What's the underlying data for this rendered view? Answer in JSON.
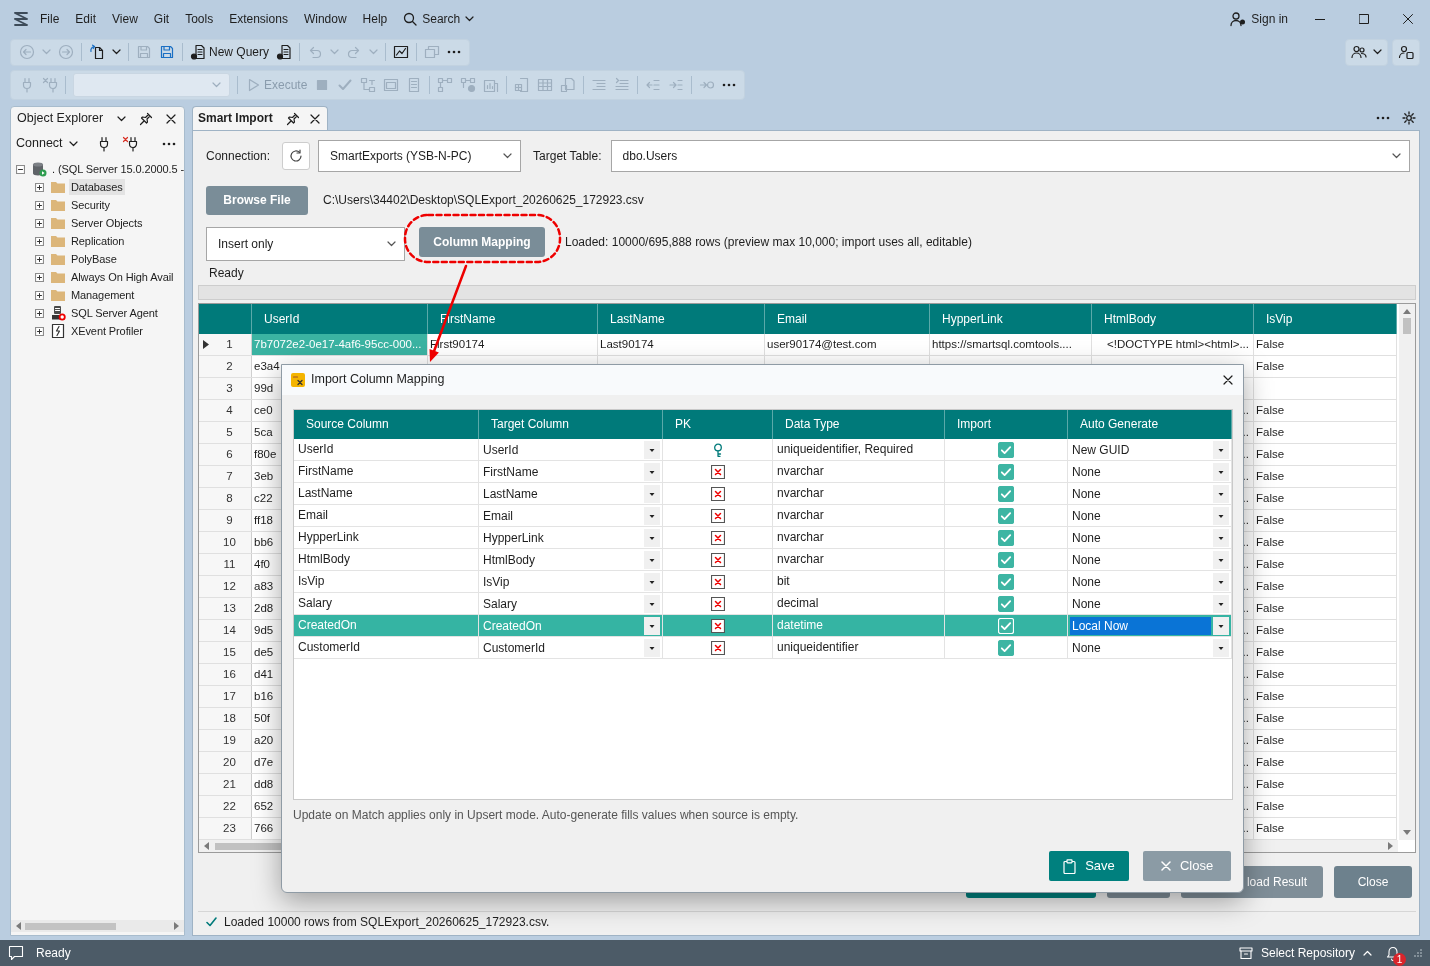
{
  "menu": {
    "items": [
      "File",
      "Edit",
      "View",
      "Git",
      "Tools",
      "Extensions",
      "Window",
      "Help"
    ],
    "search": "Search"
  },
  "account": {
    "label": "Sign in"
  },
  "toolbars": [
    {
      "items": [
        {
          "kind": "back",
          "disabled": true
        },
        {
          "kind": "chevron",
          "disabled": true
        },
        {
          "kind": "forward",
          "disabled": true
        },
        {
          "kind": "separator"
        },
        {
          "kind": "new-file",
          "disabled": false
        },
        {
          "kind": "chevron",
          "disabled": false
        },
        {
          "kind": "separator"
        },
        {
          "kind": "save",
          "disabled": true
        },
        {
          "kind": "save-all",
          "disabled": false
        },
        {
          "kind": "separator"
        },
        {
          "kind": "new-query",
          "label": "New Query",
          "disabled": false
        },
        {
          "kind": "query-file",
          "disabled": false
        },
        {
          "kind": "separator"
        },
        {
          "kind": "undo",
          "disabled": true
        },
        {
          "kind": "chevron",
          "disabled": true
        },
        {
          "kind": "redo",
          "disabled": true
        },
        {
          "kind": "chevron",
          "disabled": true
        },
        {
          "kind": "separator"
        },
        {
          "kind": "monitor",
          "disabled": false
        },
        {
          "kind": "separator"
        },
        {
          "kind": "window",
          "disabled": true
        },
        {
          "kind": "more",
          "disabled": false
        }
      ],
      "right": [
        {
          "items": [
            {
              "kind": "people",
              "disabled": false
            },
            {
              "kind": "chevron",
              "disabled": false
            }
          ]
        },
        {
          "items": [
            {
              "kind": "feedback",
              "disabled": false
            }
          ]
        }
      ]
    },
    {
      "items": [
        {
          "kind": "plug",
          "disabled": true
        },
        {
          "kind": "plug-x",
          "disabled": true
        },
        {
          "kind": "separator"
        },
        {
          "kind": "combo",
          "disabled": true
        },
        {
          "kind": "separator"
        },
        {
          "kind": "execute",
          "label": "Execute",
          "disabled": true
        },
        {
          "kind": "stop",
          "disabled": true
        },
        {
          "kind": "check",
          "disabled": true
        },
        {
          "kind": "diagram",
          "disabled": true
        },
        {
          "kind": "windows",
          "disabled": true
        },
        {
          "kind": "sheet",
          "disabled": true
        },
        {
          "kind": "separator"
        },
        {
          "kind": "flow",
          "disabled": true
        },
        {
          "kind": "flow-check",
          "disabled": true
        },
        {
          "kind": "bars",
          "disabled": true
        },
        {
          "kind": "separator"
        },
        {
          "kind": "doc-grid",
          "disabled": true
        },
        {
          "kind": "table",
          "disabled": true
        },
        {
          "kind": "doc-small",
          "disabled": true
        },
        {
          "kind": "separator"
        },
        {
          "kind": "comment",
          "disabled": true
        },
        {
          "kind": "uncomment",
          "disabled": true
        },
        {
          "kind": "separator"
        },
        {
          "kind": "outdent",
          "disabled": true
        },
        {
          "kind": "indent",
          "disabled": true
        },
        {
          "kind": "separator"
        },
        {
          "kind": "mail-arrow",
          "disabled": true
        },
        {
          "kind": "more",
          "disabled": false
        }
      ]
    }
  ],
  "object_explorer": {
    "title": "Object Explorer",
    "connect": "Connect",
    "tree": [
      {
        "label": ". (SQL Server 15.0.2000.5 -",
        "kind": "server",
        "expanded": true,
        "selected": false,
        "children": [
          {
            "label": "Databases",
            "kind": "folder",
            "expanded": false,
            "selected": true
          },
          {
            "label": "Security",
            "kind": "folder",
            "expanded": false,
            "selected": false
          },
          {
            "label": "Server Objects",
            "kind": "folder",
            "expanded": false,
            "selected": false
          },
          {
            "label": "Replication",
            "kind": "folder",
            "expanded": false,
            "selected": false
          },
          {
            "label": "PolyBase",
            "kind": "folder",
            "expanded": false,
            "selected": false
          },
          {
            "label": "Always On High Avail",
            "kind": "folder",
            "expanded": false,
            "selected": false
          },
          {
            "label": "Management",
            "kind": "folder",
            "expanded": false,
            "selected": false
          },
          {
            "label": "SQL Server Agent",
            "kind": "agent",
            "expanded": false,
            "selected": false
          },
          {
            "label": "XEvent Profiler",
            "kind": "profiler",
            "expanded": false,
            "selected": false
          }
        ]
      }
    ]
  },
  "document": {
    "tab": "Smart Import",
    "connection_label": "Connection:",
    "connection": "SmartExports (YSB-N-PC)",
    "target_table_label": "Target Table:",
    "target_table": "dbo.Users",
    "browse_button": "Browse File",
    "file_path": "C:\\Users\\34402\\Desktop\\SQLExport_20260625_172923.csv",
    "mode": "Insert only",
    "mapping_button": "Column Mapping",
    "loaded_info": "Loaded: 10000/695,888 rows (preview max 10,000; import uses all, editable)",
    "status": "Ready",
    "grid": {
      "columns": [
        "UserId",
        "FirstName",
        "LastName",
        "Email",
        "HypperLink",
        "HtmlBody",
        "IsVip"
      ],
      "rows": [
        {
          "number": "1",
          "current": true,
          "user_id": "7b7072e2-0e17-4af6-95cc-000...",
          "first_name": "First90174",
          "last_name": "Last90174",
          "email": "user90174@test.com",
          "hyperlink": "https://smartsql.comtools....",
          "html_body": "<!DOCTYPE html><html>...",
          "is_vip": "False"
        },
        {
          "number": "2",
          "current": false,
          "user_id": "e3a4",
          "is_vip": "False"
        },
        {
          "number": "3",
          "current": false,
          "user_id": "99d"
        },
        {
          "number": "4",
          "current": false,
          "user_id": "ce0",
          "html_body": "..",
          "is_vip": "False"
        },
        {
          "number": "5",
          "current": false,
          "user_id": "5ca",
          "html_body": "..",
          "is_vip": "False"
        },
        {
          "number": "6",
          "current": false,
          "user_id": "f80e",
          "html_body": "..",
          "is_vip": "False"
        },
        {
          "number": "7",
          "current": false,
          "user_id": "3eb",
          "html_body": "..",
          "is_vip": "False"
        },
        {
          "number": "8",
          "current": false,
          "user_id": "c22",
          "html_body": "..",
          "is_vip": "False"
        },
        {
          "number": "9",
          "current": false,
          "user_id": "ff18",
          "html_body": "..",
          "is_vip": "False"
        },
        {
          "number": "10",
          "current": false,
          "user_id": "bb6",
          "html_body": "..",
          "is_vip": "False"
        },
        {
          "number": "11",
          "current": false,
          "user_id": "4f0",
          "html_body": "..",
          "is_vip": "False"
        },
        {
          "number": "12",
          "current": false,
          "user_id": "a83",
          "html_body": "..",
          "is_vip": "False"
        },
        {
          "number": "13",
          "current": false,
          "user_id": "2d8",
          "html_body": "..",
          "is_vip": "False"
        },
        {
          "number": "14",
          "current": false,
          "user_id": "9d5",
          "html_body": "..",
          "is_vip": "False"
        },
        {
          "number": "15",
          "current": false,
          "user_id": "de5",
          "html_body": "..",
          "is_vip": "False"
        },
        {
          "number": "16",
          "current": false,
          "user_id": "d41",
          "html_body": "..",
          "is_vip": "False"
        },
        {
          "number": "17",
          "current": false,
          "user_id": "b16",
          "html_body": "..",
          "is_vip": "False"
        },
        {
          "number": "18",
          "current": false,
          "user_id": "50f",
          "html_body": "..",
          "is_vip": "False"
        },
        {
          "number": "19",
          "current": false,
          "user_id": "a20",
          "html_body": "..",
          "is_vip": "False"
        },
        {
          "number": "20",
          "current": false,
          "user_id": "d7e",
          "html_body": "..",
          "is_vip": "False"
        },
        {
          "number": "21",
          "current": false,
          "user_id": "dd8",
          "html_body": "..",
          "is_vip": "False"
        },
        {
          "number": "22",
          "current": false,
          "user_id": "652",
          "html_body": "..",
          "is_vip": "False"
        },
        {
          "number": "23",
          "current": false,
          "user_id": "766",
          "html_body": "..",
          "is_vip": "False"
        }
      ]
    },
    "buttons": [
      {
        "kind": "primary",
        "disabled": false
      },
      {
        "kind": "secondary",
        "disabled": true
      },
      {
        "kind": "secondary",
        "disabled": true,
        "label": "load Result"
      },
      {
        "kind": "secondary",
        "disabled": false,
        "label": "Close"
      }
    ],
    "message": "Loaded 10000 rows from SQLExport_20260625_172923.csv."
  },
  "mapping_dialog": {
    "title": "Import Column Mapping",
    "columns": [
      "Source Column",
      "Target Column",
      "PK",
      "Data Type",
      "Import",
      "Auto Generate"
    ],
    "rows": [
      {
        "source": "UserId",
        "target": "UserId",
        "pk": true,
        "data_type": "uniqueidentifier, Required",
        "import": true,
        "auto_generate": "New GUID",
        "selected": false,
        "editing": false
      },
      {
        "source": "FirstName",
        "target": "FirstName",
        "pk": false,
        "data_type": "nvarchar",
        "import": true,
        "auto_generate": "None",
        "selected": false,
        "editing": false
      },
      {
        "source": "LastName",
        "target": "LastName",
        "pk": false,
        "data_type": "nvarchar",
        "import": true,
        "auto_generate": "None",
        "selected": false,
        "editing": false
      },
      {
        "source": "Email",
        "target": "Email",
        "pk": false,
        "data_type": "nvarchar",
        "import": true,
        "auto_generate": "None",
        "selected": false,
        "editing": false
      },
      {
        "source": "HypperLink",
        "target": "HypperLink",
        "pk": false,
        "data_type": "nvarchar",
        "import": true,
        "auto_generate": "None",
        "selected": false,
        "editing": false
      },
      {
        "source": "HtmlBody",
        "target": "HtmlBody",
        "pk": false,
        "data_type": "nvarchar",
        "import": true,
        "auto_generate": "None",
        "selected": false,
        "editing": false
      },
      {
        "source": "IsVip",
        "target": "IsVip",
        "pk": false,
        "data_type": "bit",
        "import": true,
        "auto_generate": "None",
        "selected": false,
        "editing": false
      },
      {
        "source": "Salary",
        "target": "Salary",
        "pk": false,
        "data_type": "decimal",
        "import": true,
        "auto_generate": "None",
        "selected": false,
        "editing": false
      },
      {
        "source": "CreatedOn",
        "target": "CreatedOn",
        "pk": false,
        "data_type": "datetime",
        "import": true,
        "auto_generate": "Local Now",
        "selected": true,
        "editing": true
      },
      {
        "source": "CustomerId",
        "target": "CustomerId",
        "pk": false,
        "data_type": "uniqueidentifier",
        "import": true,
        "auto_generate": "None",
        "selected": false,
        "editing": false
      }
    ],
    "note": "Update on Match applies only in Upsert mode. Auto-generate fills values when source is empty.",
    "buttons": [
      {
        "kind": "save",
        "label": "Save"
      },
      {
        "kind": "close",
        "label": "Close"
      }
    ]
  },
  "annotations": [
    {
      "kind": "ring"
    },
    {
      "kind": "arrow"
    }
  ],
  "status_bar": {
    "text": "Ready",
    "repository": "Select Repository",
    "notifications": "1"
  }
}
